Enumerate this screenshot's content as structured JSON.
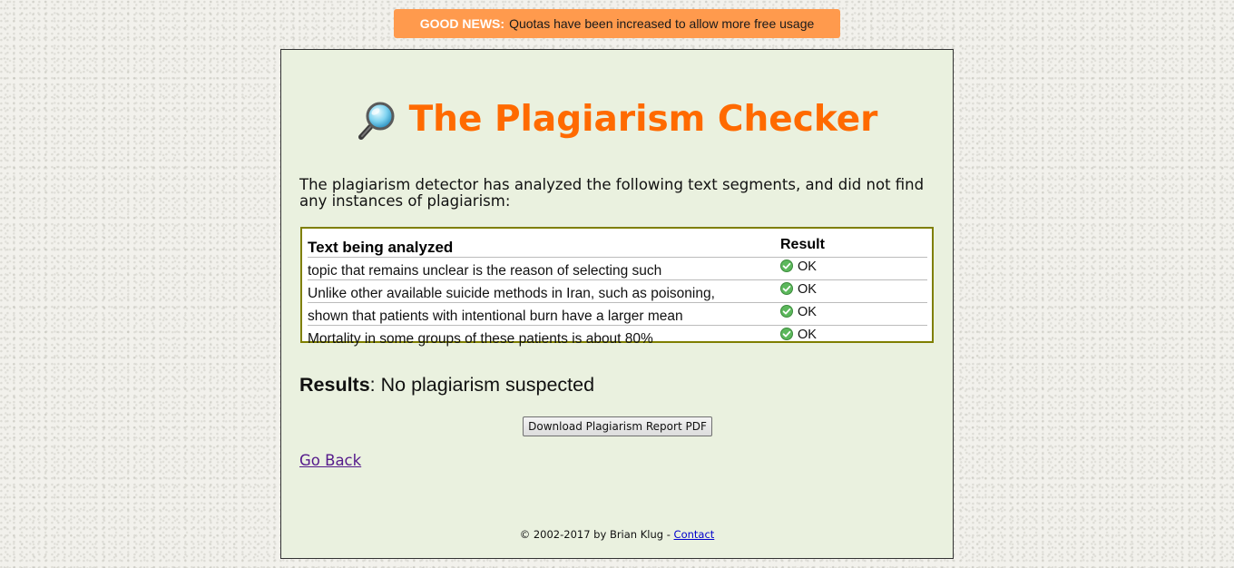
{
  "banner": {
    "label": "GOOD NEWS:",
    "text": "Quotas have been increased to allow more free usage"
  },
  "header": {
    "title": "The Plagiarism Checker",
    "icon": "magnifier-icon"
  },
  "intro": "The plagiarism detector has analyzed the following text segments, and did not find any instances of plagiarism:",
  "table": {
    "headers": {
      "text": "Text being analyzed",
      "result": "Result"
    },
    "rows": [
      {
        "text": "topic that remains unclear is the reason of selecting such",
        "result": "OK"
      },
      {
        "text": "Unlike other available suicide methods in Iran, such as poisoning,",
        "result": "OK"
      },
      {
        "text": "shown that patients with intentional burn have a larger mean",
        "result": "OK"
      },
      {
        "text": "Mortality in some groups of these patients is about 80%",
        "result": "OK"
      }
    ]
  },
  "results": {
    "label": "Results",
    "value": ": No plagiarism suspected"
  },
  "download_button": "Download Plagiarism Report PDF",
  "go_back": "Go Back",
  "footer": {
    "copyright": "© 2002-2017 by Brian Klug - ",
    "contact": "Contact"
  },
  "colors": {
    "banner": "#ff9a4d",
    "title": "#ff6a00",
    "panel": "#eaf1df",
    "table_border": "#7f7f00",
    "ok_icon": "#4caf50"
  }
}
